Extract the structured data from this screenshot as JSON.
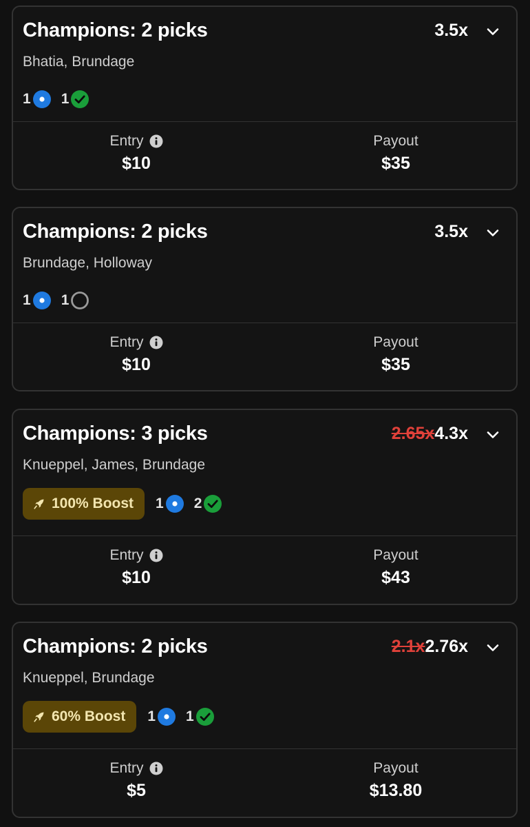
{
  "colors": {
    "background": "#111111",
    "card_border": "#333333",
    "strike_red": "#e0413a",
    "boost_bg": "#5b4607",
    "pending_blue": "#1f7ae0",
    "win_green": "#1a9e3a"
  },
  "cards": [
    {
      "title": "Champions: 2 picks",
      "old_multiplier": "",
      "multiplier": "3.5x",
      "players": "Bhatia, Brundage",
      "boost": "",
      "pending_count": "1",
      "second_count": "1",
      "second_icon": "check-circle-icon",
      "entry_label": "Entry",
      "entry_value": "$10",
      "payout_label": "Payout",
      "payout_value": "$35"
    },
    {
      "title": "Champions: 2 picks",
      "old_multiplier": "",
      "multiplier": "3.5x",
      "players": "Brundage, Holloway",
      "boost": "",
      "pending_count": "1",
      "second_count": "1",
      "second_icon": "empty-circle-icon",
      "entry_label": "Entry",
      "entry_value": "$10",
      "payout_label": "Payout",
      "payout_value": "$35"
    },
    {
      "title": "Champions: 3 picks",
      "old_multiplier": "2.65x",
      "multiplier": "4.3x",
      "players": "Knueppel, James, Brundage",
      "boost": "100% Boost",
      "pending_count": "1",
      "second_count": "2",
      "second_icon": "check-circle-icon",
      "entry_label": "Entry",
      "entry_value": "$10",
      "payout_label": "Payout",
      "payout_value": "$43"
    },
    {
      "title": "Champions: 2 picks",
      "old_multiplier": "2.1x",
      "multiplier": "2.76x",
      "players": "Knueppel, Brundage",
      "boost": "60% Boost",
      "pending_count": "1",
      "second_count": "1",
      "second_icon": "check-circle-icon",
      "entry_label": "Entry",
      "entry_value": "$5",
      "payout_label": "Payout",
      "payout_value": "$13.80"
    }
  ]
}
